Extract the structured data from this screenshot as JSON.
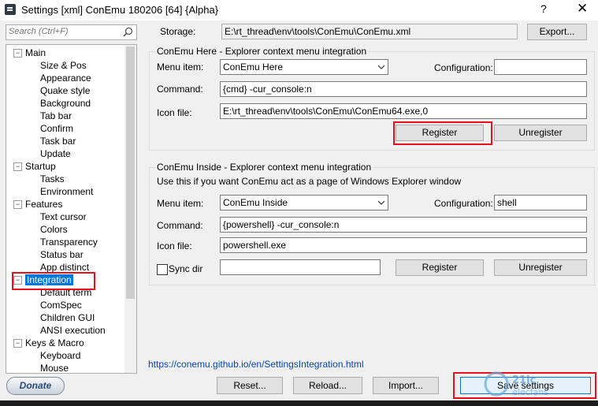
{
  "window": {
    "title": "Settings [xml] ConEmu 180206 [64] {Alpha}",
    "help_glyph": "?",
    "close_glyph": "✕"
  },
  "search": {
    "placeholder": "Search (Ctrl+F)"
  },
  "tree": [
    {
      "label": "Main",
      "level": 0,
      "toggle": "−"
    },
    {
      "label": "Size & Pos",
      "level": 1
    },
    {
      "label": "Appearance",
      "level": 1
    },
    {
      "label": "Quake style",
      "level": 1
    },
    {
      "label": "Background",
      "level": 1
    },
    {
      "label": "Tab bar",
      "level": 1
    },
    {
      "label": "Confirm",
      "level": 1
    },
    {
      "label": "Task bar",
      "level": 1
    },
    {
      "label": "Update",
      "level": 1
    },
    {
      "label": "Startup",
      "level": 0,
      "toggle": "−"
    },
    {
      "label": "Tasks",
      "level": 1
    },
    {
      "label": "Environment",
      "level": 1
    },
    {
      "label": "Features",
      "level": 0,
      "toggle": "−"
    },
    {
      "label": "Text cursor",
      "level": 1
    },
    {
      "label": "Colors",
      "level": 1
    },
    {
      "label": "Transparency",
      "level": 1
    },
    {
      "label": "Status bar",
      "level": 1
    },
    {
      "label": "App distinct",
      "level": 1
    },
    {
      "label": "Integration",
      "level": 0,
      "toggle": "−",
      "selected": true
    },
    {
      "label": "Default term",
      "level": 1
    },
    {
      "label": "ComSpec",
      "level": 1
    },
    {
      "label": "Children GUI",
      "level": 1
    },
    {
      "label": "ANSI execution",
      "level": 1
    },
    {
      "label": "Keys & Macro",
      "level": 0,
      "toggle": "−"
    },
    {
      "label": "Keyboard",
      "level": 1
    },
    {
      "label": "Mouse",
      "level": 1
    }
  ],
  "storage": {
    "label": "Storage:",
    "value": "E:\\rt_thread\\env\\tools\\ConEmu\\ConEmu.xml",
    "export_label": "Export..."
  },
  "here_group": {
    "title": "ConEmu Here - Explorer context menu integration",
    "menu_item_label": "Menu item:",
    "menu_item_value": "ConEmu Here",
    "configuration_label": "Configuration:",
    "configuration_value": "",
    "command_label": "Command:",
    "command_value": "{cmd} -cur_console:n",
    "icon_label": "Icon file:",
    "icon_value": "E:\\rt_thread\\env\\tools\\ConEmu\\ConEmu64.exe,0",
    "register_label": "Register",
    "unregister_label": "Unregister"
  },
  "inside_group": {
    "title": "ConEmu Inside - Explorer context menu integration",
    "description": "Use this if you want ConEmu act as a page of Windows Explorer window",
    "menu_item_label": "Menu item:",
    "menu_item_value": "ConEmu Inside",
    "configuration_label": "Configuration:",
    "configuration_value": "shell",
    "command_label": "Command:",
    "command_value": "{powershell} -cur_console:n",
    "icon_label": "Icon file:",
    "icon_value": "powershell.exe",
    "sync_dir_label": "Sync dir",
    "sync_dir_checked": false,
    "sync_dir_value": "",
    "register_label": "Register",
    "unregister_label": "Unregister"
  },
  "help_link": "https://conemu.github.io/en/SettingsIntegration.html",
  "footer": {
    "donate_label": "Donate",
    "reset_label": "Reset...",
    "reload_label": "Reload...",
    "import_label": "Import...",
    "save_label": "Save settings"
  },
  "colors": {
    "highlight_box": "#e8101a",
    "selection": "#0078d7",
    "link": "#0645ad"
  }
}
